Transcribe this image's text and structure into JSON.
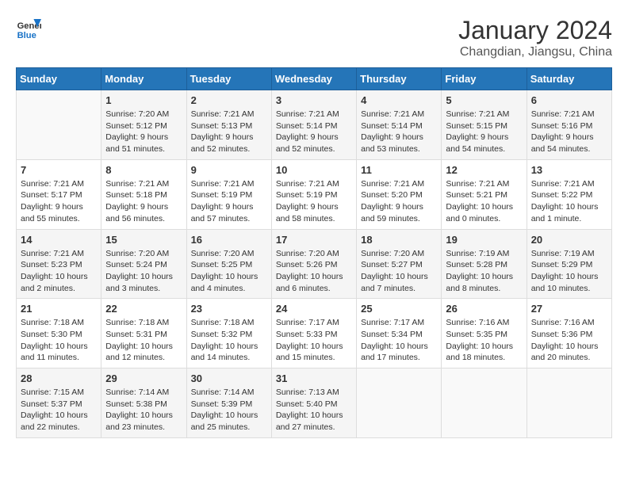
{
  "header": {
    "logo_general": "General",
    "logo_blue": "Blue",
    "month": "January 2024",
    "location": "Changdian, Jiangsu, China"
  },
  "weekdays": [
    "Sunday",
    "Monday",
    "Tuesday",
    "Wednesday",
    "Thursday",
    "Friday",
    "Saturday"
  ],
  "weeks": [
    [
      {
        "day": "",
        "info": ""
      },
      {
        "day": "1",
        "info": "Sunrise: 7:20 AM\nSunset: 5:12 PM\nDaylight: 9 hours\nand 51 minutes."
      },
      {
        "day": "2",
        "info": "Sunrise: 7:21 AM\nSunset: 5:13 PM\nDaylight: 9 hours\nand 52 minutes."
      },
      {
        "day": "3",
        "info": "Sunrise: 7:21 AM\nSunset: 5:14 PM\nDaylight: 9 hours\nand 52 minutes."
      },
      {
        "day": "4",
        "info": "Sunrise: 7:21 AM\nSunset: 5:14 PM\nDaylight: 9 hours\nand 53 minutes."
      },
      {
        "day": "5",
        "info": "Sunrise: 7:21 AM\nSunset: 5:15 PM\nDaylight: 9 hours\nand 54 minutes."
      },
      {
        "day": "6",
        "info": "Sunrise: 7:21 AM\nSunset: 5:16 PM\nDaylight: 9 hours\nand 54 minutes."
      }
    ],
    [
      {
        "day": "7",
        "info": "Sunrise: 7:21 AM\nSunset: 5:17 PM\nDaylight: 9 hours\nand 55 minutes."
      },
      {
        "day": "8",
        "info": "Sunrise: 7:21 AM\nSunset: 5:18 PM\nDaylight: 9 hours\nand 56 minutes."
      },
      {
        "day": "9",
        "info": "Sunrise: 7:21 AM\nSunset: 5:19 PM\nDaylight: 9 hours\nand 57 minutes."
      },
      {
        "day": "10",
        "info": "Sunrise: 7:21 AM\nSunset: 5:19 PM\nDaylight: 9 hours\nand 58 minutes."
      },
      {
        "day": "11",
        "info": "Sunrise: 7:21 AM\nSunset: 5:20 PM\nDaylight: 9 hours\nand 59 minutes."
      },
      {
        "day": "12",
        "info": "Sunrise: 7:21 AM\nSunset: 5:21 PM\nDaylight: 10 hours\nand 0 minutes."
      },
      {
        "day": "13",
        "info": "Sunrise: 7:21 AM\nSunset: 5:22 PM\nDaylight: 10 hours\nand 1 minute."
      }
    ],
    [
      {
        "day": "14",
        "info": "Sunrise: 7:21 AM\nSunset: 5:23 PM\nDaylight: 10 hours\nand 2 minutes."
      },
      {
        "day": "15",
        "info": "Sunrise: 7:20 AM\nSunset: 5:24 PM\nDaylight: 10 hours\nand 3 minutes."
      },
      {
        "day": "16",
        "info": "Sunrise: 7:20 AM\nSunset: 5:25 PM\nDaylight: 10 hours\nand 4 minutes."
      },
      {
        "day": "17",
        "info": "Sunrise: 7:20 AM\nSunset: 5:26 PM\nDaylight: 10 hours\nand 6 minutes."
      },
      {
        "day": "18",
        "info": "Sunrise: 7:20 AM\nSunset: 5:27 PM\nDaylight: 10 hours\nand 7 minutes."
      },
      {
        "day": "19",
        "info": "Sunrise: 7:19 AM\nSunset: 5:28 PM\nDaylight: 10 hours\nand 8 minutes."
      },
      {
        "day": "20",
        "info": "Sunrise: 7:19 AM\nSunset: 5:29 PM\nDaylight: 10 hours\nand 10 minutes."
      }
    ],
    [
      {
        "day": "21",
        "info": "Sunrise: 7:18 AM\nSunset: 5:30 PM\nDaylight: 10 hours\nand 11 minutes."
      },
      {
        "day": "22",
        "info": "Sunrise: 7:18 AM\nSunset: 5:31 PM\nDaylight: 10 hours\nand 12 minutes."
      },
      {
        "day": "23",
        "info": "Sunrise: 7:18 AM\nSunset: 5:32 PM\nDaylight: 10 hours\nand 14 minutes."
      },
      {
        "day": "24",
        "info": "Sunrise: 7:17 AM\nSunset: 5:33 PM\nDaylight: 10 hours\nand 15 minutes."
      },
      {
        "day": "25",
        "info": "Sunrise: 7:17 AM\nSunset: 5:34 PM\nDaylight: 10 hours\nand 17 minutes."
      },
      {
        "day": "26",
        "info": "Sunrise: 7:16 AM\nSunset: 5:35 PM\nDaylight: 10 hours\nand 18 minutes."
      },
      {
        "day": "27",
        "info": "Sunrise: 7:16 AM\nSunset: 5:36 PM\nDaylight: 10 hours\nand 20 minutes."
      }
    ],
    [
      {
        "day": "28",
        "info": "Sunrise: 7:15 AM\nSunset: 5:37 PM\nDaylight: 10 hours\nand 22 minutes."
      },
      {
        "day": "29",
        "info": "Sunrise: 7:14 AM\nSunset: 5:38 PM\nDaylight: 10 hours\nand 23 minutes."
      },
      {
        "day": "30",
        "info": "Sunrise: 7:14 AM\nSunset: 5:39 PM\nDaylight: 10 hours\nand 25 minutes."
      },
      {
        "day": "31",
        "info": "Sunrise: 7:13 AM\nSunset: 5:40 PM\nDaylight: 10 hours\nand 27 minutes."
      },
      {
        "day": "",
        "info": ""
      },
      {
        "day": "",
        "info": ""
      },
      {
        "day": "",
        "info": ""
      }
    ]
  ]
}
